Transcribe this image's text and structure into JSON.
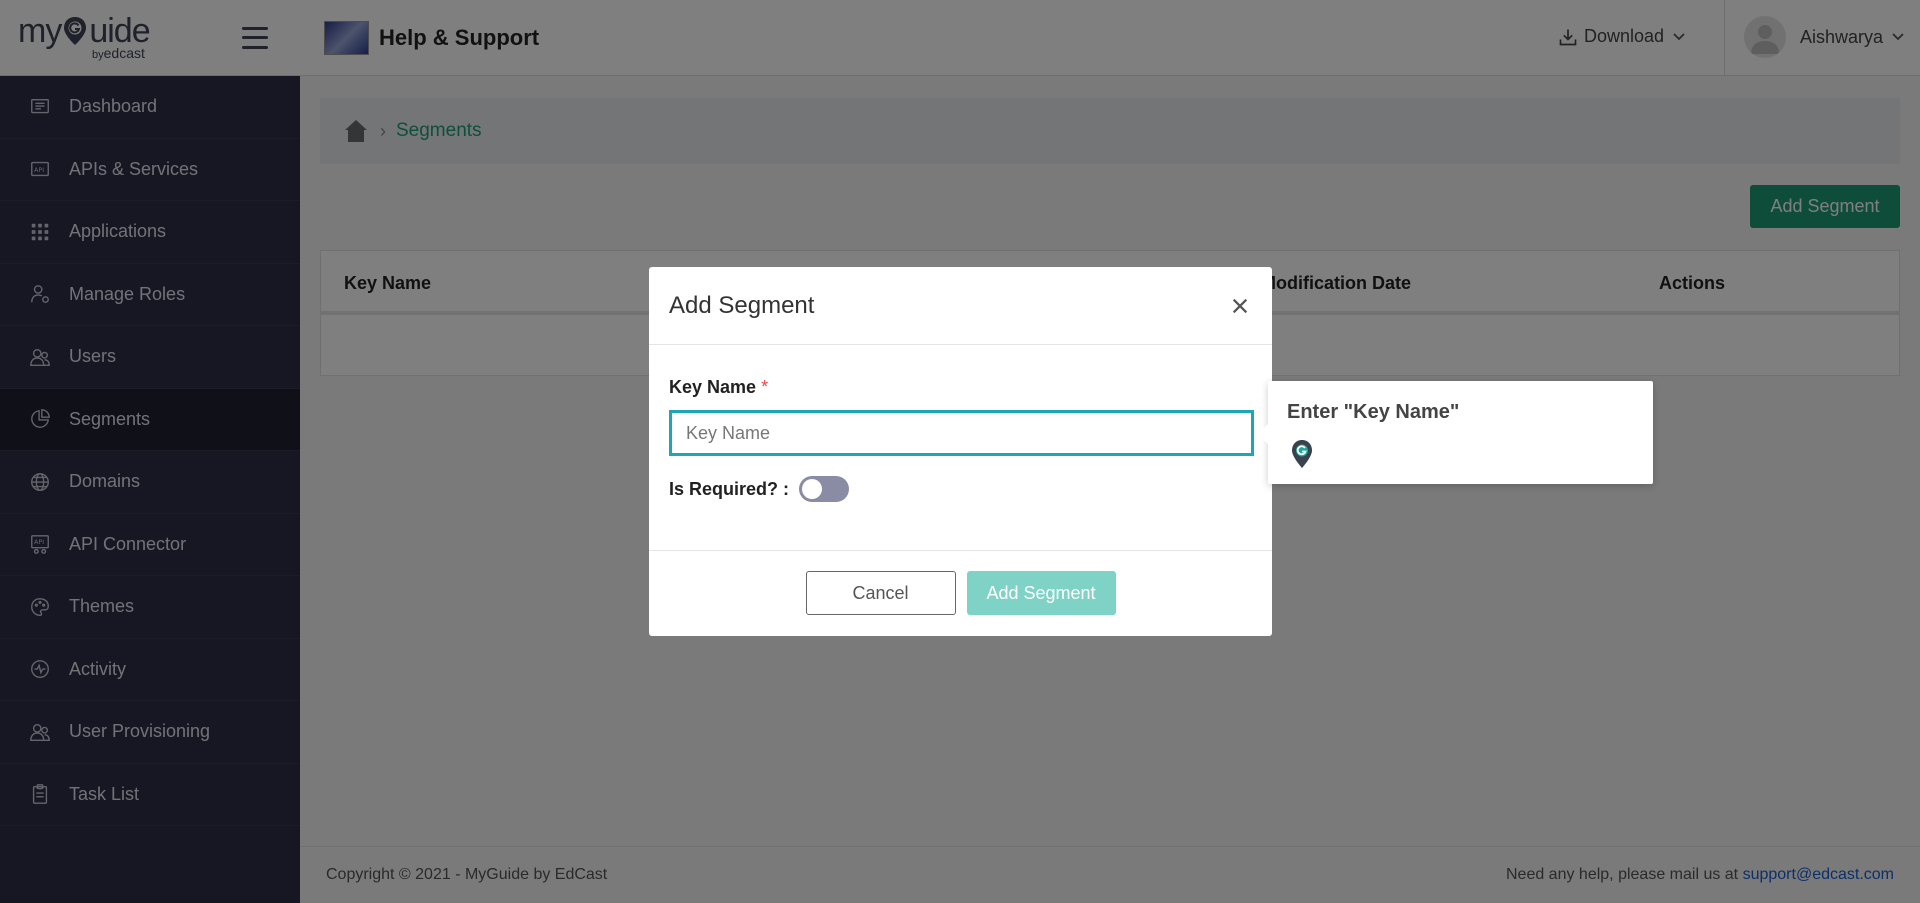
{
  "sidebar": {
    "logo_main_left": "my",
    "logo_main_right": "uide",
    "logo_sub_by": "by",
    "logo_sub_brand": "edcast",
    "items": [
      {
        "label": "Dashboard",
        "icon": "dashboard-icon"
      },
      {
        "label": "APIs & Services",
        "icon": "api-icon"
      },
      {
        "label": "Applications",
        "icon": "grid-icon"
      },
      {
        "label": "Manage Roles",
        "icon": "user-gear-icon"
      },
      {
        "label": "Users",
        "icon": "users-icon"
      },
      {
        "label": "Segments",
        "icon": "pie-chart-icon",
        "active": true
      },
      {
        "label": "Domains",
        "icon": "globe-icon"
      },
      {
        "label": "API Connector",
        "icon": "api-connector-icon"
      },
      {
        "label": "Themes",
        "icon": "palette-icon"
      },
      {
        "label": "Activity",
        "icon": "activity-icon"
      },
      {
        "label": "User Provisioning",
        "icon": "users-icon"
      },
      {
        "label": "Task List",
        "icon": "clipboard-icon"
      }
    ]
  },
  "header": {
    "app_title": "Help & Support",
    "download_label": "Download",
    "user_name": "Aishwarya"
  },
  "breadcrumb": {
    "current": "Segments"
  },
  "main": {
    "add_segment_label": "Add Segment",
    "table": {
      "columns": [
        "Key Name",
        "Modification Date",
        "Actions"
      ]
    }
  },
  "modal": {
    "title": "Add Segment",
    "key_name_label": "Key Name",
    "required_mark": "*",
    "key_name_placeholder": "Key Name",
    "key_name_value": "",
    "is_required_label": "Is Required? :",
    "is_required_on": false,
    "cancel_label": "Cancel",
    "add_label": "Add Segment"
  },
  "tooltip": {
    "text": "Enter \"Key Name\""
  },
  "footer": {
    "copyright": "Copyright © 2021 - MyGuide by EdCast",
    "help_text": "Need any help, please mail us at ",
    "help_email": "support@edcast.com"
  },
  "colors": {
    "sidebar_bg": "#2c2f45",
    "accent_green": "#1d9a74",
    "input_focus": "#1da6b5",
    "add_disabled": "#7fd3c6",
    "link_blue": "#1a5fd1"
  }
}
